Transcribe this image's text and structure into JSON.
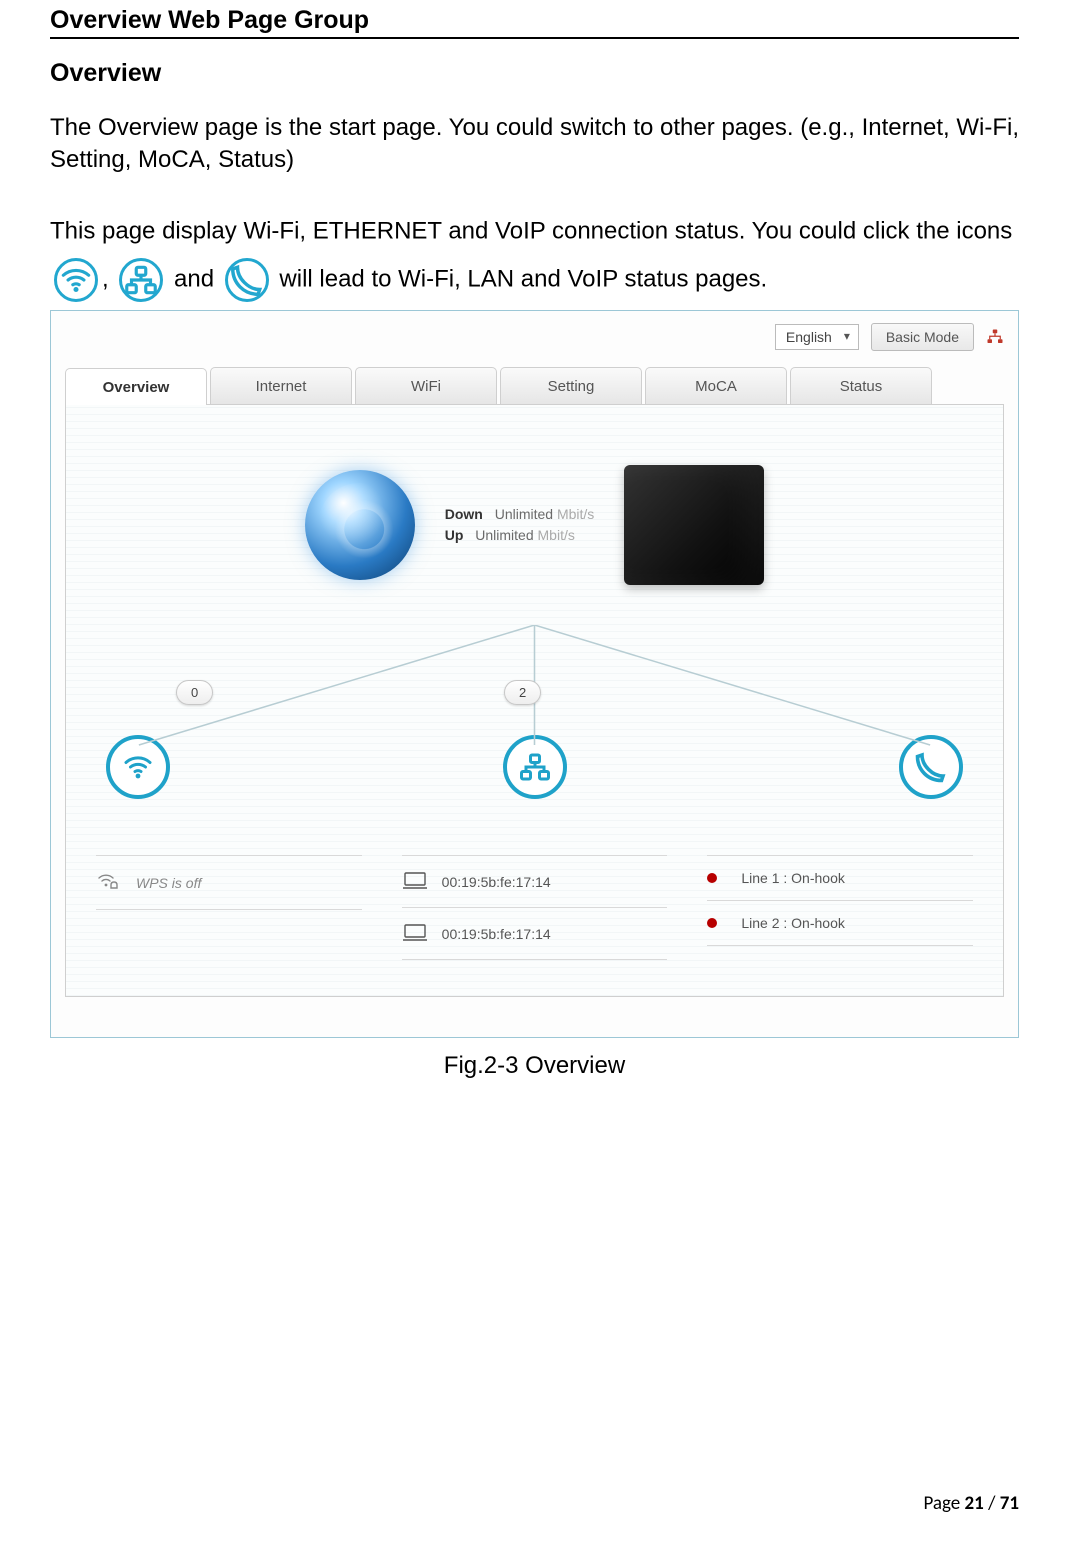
{
  "doc": {
    "section_title": "Overview Web Page Group",
    "subsection_title": "Overview",
    "para1": "The Overview page is the start page. You could switch to other pages. (e.g., Internet, Wi-Fi, Setting, MoCA, Status)",
    "para2_a": "This page display Wi-Fi, ETHERNET and VoIP connection status. You could click the icons",
    "para2_comma": ",",
    "para2_and": "and",
    "para2_b": "will lead to Wi-Fi, LAN and VoIP status pages.",
    "caption": "Fig.2-3 Overview",
    "page_label_prefix": "Page ",
    "page_current": "21",
    "page_sep": " / ",
    "page_total": "71"
  },
  "shot": {
    "topbar": {
      "language": "English",
      "mode_button": "Basic Mode"
    },
    "tabs": [
      "Overview",
      "Internet",
      "WiFi",
      "Setting",
      "MoCA",
      "Status"
    ],
    "active_tab_index": 0,
    "speed": {
      "down_label": "Down",
      "down_value": "Unlimited",
      "down_unit": "Mbit/s",
      "up_label": "Up",
      "up_value": "Unlimited",
      "up_unit": "Mbit/s"
    },
    "chips": {
      "wifi_count": "0",
      "lan_count": "2"
    },
    "wifi": {
      "wps_text": "WPS is off"
    },
    "lan": {
      "devices": [
        {
          "mac": "00:19:5b:fe:17:14"
        },
        {
          "mac": "00:19:5b:fe:17:14"
        }
      ]
    },
    "voip": {
      "lines": [
        {
          "text": "Line 1 : On-hook"
        },
        {
          "text": "Line 2 : On-hook"
        }
      ]
    }
  }
}
